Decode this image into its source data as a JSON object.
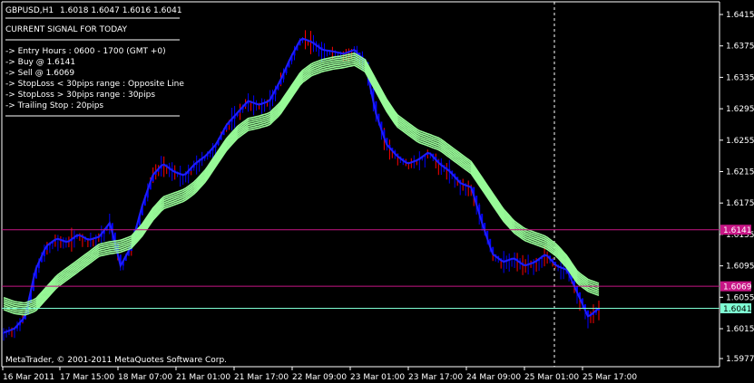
{
  "header": {
    "symbol": "GBPUSD,H1",
    "ohlc": "1.6018 1.6047 1.6016 1.6041"
  },
  "signal_panel": {
    "title": "CURRENT SIGNAL FOR TODAY",
    "lines": [
      "-> Entry Hours : 0600 - 1700 (GMT +0)",
      "-> Buy @ 1.6141",
      "-> Sell @ 1.6069",
      "-> StopLoss < 30pips range : Opposite Line",
      "-> StopLoss > 30pips range : 30pips",
      "-> Trailing Stop : 20pips"
    ]
  },
  "copyright": "MetaTrader, © 2001-2011 MetaQuotes Software Corp.",
  "price_levels": {
    "buy": "1.6141",
    "sell": "1.6069",
    "current": "1.6041"
  },
  "colors": {
    "background": "#000000",
    "axis": "#ffffff",
    "candles": "#0000ff",
    "wicks_down": "#ff0000",
    "ribbon": "#98fb98",
    "buy_line": "#c71585",
    "sell_line": "#c71585",
    "current_line": "#7fffd4"
  },
  "chart_data": {
    "type": "line",
    "title": "",
    "xlabel": "",
    "ylabel": "",
    "ylim": [
      1.5977,
      1.6415
    ],
    "y_ticks": [
      "1.6415",
      "1.6375",
      "1.6335",
      "1.6295",
      "1.6255",
      "1.6215",
      "1.6175",
      "1.6135",
      "1.6095",
      "1.6055",
      "1.6015",
      "1.5977"
    ],
    "x_ticks": [
      "16 Mar 2011",
      "17 Mar 15:00",
      "18 Mar 07:00",
      "21 Mar 01:00",
      "21 Mar 17:00",
      "22 Mar 09:00",
      "23 Mar 01:00",
      "23 Mar 17:00",
      "24 Mar 09:00",
      "25 Mar 01:00",
      "25 Mar 17:00"
    ],
    "series": [
      {
        "values": [
          1.601,
          1.6015,
          1.603,
          1.609,
          1.612,
          1.613,
          1.6125,
          1.6135,
          1.6128,
          1.6132,
          1.615,
          1.6095,
          1.612,
          1.617,
          1.621,
          1.6225,
          1.6215,
          1.621,
          1.6225,
          1.6235,
          1.625,
          1.6275,
          1.629,
          1.6305,
          1.63,
          1.6305,
          1.633,
          1.636,
          1.6385,
          1.638,
          1.637,
          1.6368,
          1.6365,
          1.637,
          1.6355,
          1.629,
          1.625,
          1.6235,
          1.6225,
          1.623,
          1.624,
          1.6225,
          1.6215,
          1.62,
          1.6195,
          1.615,
          1.611,
          1.61,
          1.6105,
          1.6095,
          1.61,
          1.611,
          1.6095,
          1.609,
          1.606,
          1.603,
          1.6041
        ]
      },
      {
        "values": [
          1.6047,
          1.6042,
          1.604,
          1.6045,
          1.606,
          1.6075,
          1.6085,
          1.6095,
          1.6105,
          1.6115,
          1.6118,
          1.612,
          1.6125,
          1.614,
          1.616,
          1.6175,
          1.618,
          1.6185,
          1.6195,
          1.621,
          1.623,
          1.625,
          1.6265,
          1.6275,
          1.6278,
          1.6282,
          1.6295,
          1.6315,
          1.6335,
          1.6345,
          1.635,
          1.6353,
          1.6355,
          1.6358,
          1.635,
          1.6325,
          1.63,
          1.628,
          1.627,
          1.626,
          1.6255,
          1.625,
          1.624,
          1.623,
          1.622,
          1.62,
          1.618,
          1.616,
          1.6145,
          1.6135,
          1.613,
          1.6125,
          1.6115,
          1.61,
          1.608,
          1.607,
          1.6065
        ]
      }
    ]
  }
}
